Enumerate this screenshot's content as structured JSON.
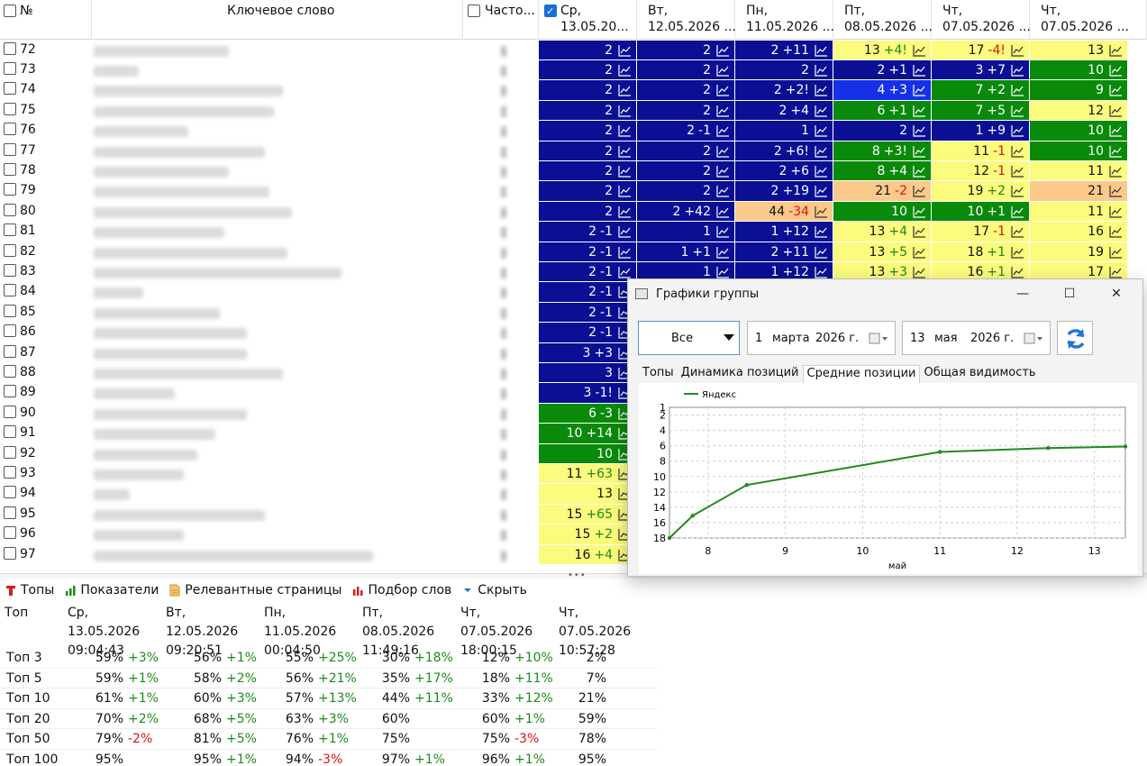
{
  "grid": {
    "header": {
      "num_label": "№",
      "keyword_label": "Ключевое слово",
      "freq_label": "Часто...",
      "date_columns": [
        {
          "day": "Ср,",
          "date": "13.05.20..."
        },
        {
          "day": "Вт,",
          "date": "12.05.2026 ..."
        },
        {
          "day": "Пн,",
          "date": "11.05.2026 ..."
        },
        {
          "day": "Пт,",
          "date": "08.05.2026 ..."
        },
        {
          "day": "Чт,",
          "date": "07.05.2026 ..."
        },
        {
          "day": "Чт,",
          "date": "07.05.2026 ..."
        }
      ]
    },
    "colors": {
      "navy": "#0a0f94",
      "blue": "#1530e6",
      "green": "#0a8a0a",
      "yellow": "#fbfb7d",
      "peach": "#fbc98a"
    },
    "rows": [
      {
        "n": "72",
        "kw_w": 150,
        "cells": [
          [
            "2",
            "",
            "navy"
          ],
          [
            "2",
            "",
            "navy"
          ],
          [
            "2",
            "+11",
            "navy"
          ],
          [
            "13",
            "+4!",
            "yellow"
          ],
          [
            "17",
            "-4!",
            "yellow"
          ],
          [
            "13",
            "",
            "yellow"
          ]
        ]
      },
      {
        "n": "73",
        "kw_w": 50,
        "cells": [
          [
            "2",
            "",
            "navy"
          ],
          [
            "2",
            "",
            "navy"
          ],
          [
            "2",
            "",
            "navy"
          ],
          [
            "2",
            "+1",
            "navy"
          ],
          [
            "3",
            "+7",
            "navy"
          ],
          [
            "10",
            "",
            "green"
          ]
        ]
      },
      {
        "n": "74",
        "kw_w": 210,
        "cells": [
          [
            "2",
            "",
            "navy"
          ],
          [
            "2",
            "",
            "navy"
          ],
          [
            "2",
            "+2!",
            "navy"
          ],
          [
            "4",
            "+3",
            "blue"
          ],
          [
            "7",
            "+2",
            "green"
          ],
          [
            "9",
            "",
            "green"
          ]
        ]
      },
      {
        "n": "75",
        "kw_w": 200,
        "cells": [
          [
            "2",
            "",
            "navy"
          ],
          [
            "2",
            "",
            "navy"
          ],
          [
            "2",
            "+4",
            "navy"
          ],
          [
            "6",
            "+1",
            "green"
          ],
          [
            "7",
            "+5",
            "green"
          ],
          [
            "12",
            "",
            "yellow"
          ]
        ]
      },
      {
        "n": "76",
        "kw_w": 105,
        "cells": [
          [
            "2",
            "",
            "navy"
          ],
          [
            "2",
            "-1",
            "navy"
          ],
          [
            "1",
            "",
            "navy"
          ],
          [
            "2",
            "",
            "navy"
          ],
          [
            "1",
            "+9",
            "navy"
          ],
          [
            "10",
            "",
            "green"
          ]
        ]
      },
      {
        "n": "77",
        "kw_w": 190,
        "cells": [
          [
            "2",
            "",
            "navy"
          ],
          [
            "2",
            "",
            "navy"
          ],
          [
            "2",
            "+6!",
            "navy"
          ],
          [
            "8",
            "+3!",
            "green"
          ],
          [
            "11",
            "-1",
            "yellow"
          ],
          [
            "10",
            "",
            "green"
          ]
        ]
      },
      {
        "n": "78",
        "kw_w": 150,
        "cells": [
          [
            "2",
            "",
            "navy"
          ],
          [
            "2",
            "",
            "navy"
          ],
          [
            "2",
            "+6",
            "navy"
          ],
          [
            "8",
            "+4",
            "green"
          ],
          [
            "12",
            "-1",
            "yellow"
          ],
          [
            "11",
            "",
            "yellow"
          ]
        ]
      },
      {
        "n": "79",
        "kw_w": 195,
        "cells": [
          [
            "2",
            "",
            "navy"
          ],
          [
            "2",
            "",
            "navy"
          ],
          [
            "2",
            "+19",
            "navy"
          ],
          [
            "21",
            "-2",
            "peach"
          ],
          [
            "19",
            "+2",
            "yellow"
          ],
          [
            "21",
            "",
            "peach"
          ]
        ]
      },
      {
        "n": "80",
        "kw_w": 220,
        "cells": [
          [
            "2",
            "",
            "navy"
          ],
          [
            "2",
            "+42",
            "navy"
          ],
          [
            "44",
            "-34",
            "peach"
          ],
          [
            "10",
            "",
            "green"
          ],
          [
            "10",
            "+1",
            "green"
          ],
          [
            "11",
            "",
            "yellow"
          ]
        ]
      },
      {
        "n": "81",
        "kw_w": 145,
        "cells": [
          [
            "2",
            "-1",
            "navy"
          ],
          [
            "1",
            "",
            "navy"
          ],
          [
            "1",
            "+12",
            "navy"
          ],
          [
            "13",
            "+4",
            "yellow"
          ],
          [
            "17",
            "-1",
            "yellow"
          ],
          [
            "16",
            "",
            "yellow"
          ]
        ]
      },
      {
        "n": "82",
        "kw_w": 215,
        "cells": [
          [
            "2",
            "-1",
            "navy"
          ],
          [
            "1",
            "+1",
            "navy"
          ],
          [
            "2",
            "+11",
            "navy"
          ],
          [
            "13",
            "+5",
            "yellow"
          ],
          [
            "18",
            "+1",
            "yellow"
          ],
          [
            "19",
            "",
            "yellow"
          ]
        ]
      },
      {
        "n": "83",
        "kw_w": 275,
        "cells": [
          [
            "2",
            "-1",
            "navy"
          ],
          [
            "1",
            "",
            "navy"
          ],
          [
            "1",
            "+12",
            "navy"
          ],
          [
            "13",
            "+3",
            "yellow"
          ],
          [
            "16",
            "+1",
            "yellow"
          ],
          [
            "17",
            "",
            "yellow"
          ]
        ]
      },
      {
        "n": "84",
        "kw_w": 55,
        "cells": [
          [
            "2",
            "-1",
            "navy"
          ]
        ]
      },
      {
        "n": "85",
        "kw_w": 140,
        "cells": [
          [
            "2",
            "-1",
            "navy"
          ]
        ]
      },
      {
        "n": "86",
        "kw_w": 170,
        "cells": [
          [
            "2",
            "-1",
            "navy"
          ]
        ]
      },
      {
        "n": "87",
        "kw_w": 170,
        "cells": [
          [
            "3",
            "+3",
            "navy"
          ]
        ]
      },
      {
        "n": "88",
        "kw_w": 210,
        "cells": [
          [
            "3",
            "",
            "navy"
          ]
        ]
      },
      {
        "n": "89",
        "kw_w": 90,
        "cells": [
          [
            "3",
            "-1!",
            "navy"
          ]
        ]
      },
      {
        "n": "90",
        "kw_w": 170,
        "cells": [
          [
            "6",
            "-3",
            "green"
          ]
        ]
      },
      {
        "n": "91",
        "kw_w": 135,
        "cells": [
          [
            "10",
            "+14",
            "green"
          ]
        ]
      },
      {
        "n": "92",
        "kw_w": 115,
        "cells": [
          [
            "10",
            "",
            "green"
          ]
        ]
      },
      {
        "n": "93",
        "kw_w": 100,
        "cells": [
          [
            "11",
            "+63",
            "yellow"
          ]
        ]
      },
      {
        "n": "94",
        "kw_w": 40,
        "cells": [
          [
            "13",
            "",
            "yellow"
          ]
        ]
      },
      {
        "n": "95",
        "kw_w": 190,
        "cells": [
          [
            "15",
            "+65",
            "yellow"
          ]
        ]
      },
      {
        "n": "96",
        "kw_w": 100,
        "cells": [
          [
            "15",
            "+2",
            "yellow"
          ]
        ]
      },
      {
        "n": "97",
        "kw_w": 310,
        "cells": [
          [
            "16",
            "+4",
            "yellow"
          ]
        ]
      }
    ]
  },
  "splitter_glyph": "•••",
  "toolbar": {
    "items": [
      {
        "label": "Топы",
        "icon": "tops-icon"
      },
      {
        "label": "Показатели",
        "icon": "bar-chart-icon"
      },
      {
        "label": "Релевантные страницы",
        "icon": "document-icon"
      },
      {
        "label": "Подбор слов",
        "icon": "bar-chart-red-icon"
      },
      {
        "label": "Скрыть",
        "icon": "chevron-down-icon"
      }
    ]
  },
  "tops_table": {
    "header_label": "Топ",
    "columns": [
      {
        "day": "Ср, 13.05.2026",
        "time": "09:04:43"
      },
      {
        "day": "Вт, 12.05.2026",
        "time": "09:20:51"
      },
      {
        "day": "Пн, 11.05.2026",
        "time": "00:04:50"
      },
      {
        "day": "Пт, 08.05.2026",
        "time": "11:49:16"
      },
      {
        "day": "Чт, 07.05.2026",
        "time": "18:00:15"
      },
      {
        "day": "Чт, 07.05.2026",
        "time": "10:57:28"
      }
    ],
    "rows": [
      {
        "label": "Топ 3",
        "cells": [
          [
            "59%",
            "+3%"
          ],
          [
            "56%",
            "+1%"
          ],
          [
            "55%",
            "+25%"
          ],
          [
            "30%",
            "+18%"
          ],
          [
            "12%",
            "+10%"
          ],
          [
            "2%",
            ""
          ]
        ]
      },
      {
        "label": "Топ 5",
        "cells": [
          [
            "59%",
            "+1%"
          ],
          [
            "58%",
            "+2%"
          ],
          [
            "56%",
            "+21%"
          ],
          [
            "35%",
            "+17%"
          ],
          [
            "18%",
            "+11%"
          ],
          [
            "7%",
            ""
          ]
        ]
      },
      {
        "label": "Топ 10",
        "cells": [
          [
            "61%",
            "+1%"
          ],
          [
            "60%",
            "+3%"
          ],
          [
            "57%",
            "+13%"
          ],
          [
            "44%",
            "+11%"
          ],
          [
            "33%",
            "+12%"
          ],
          [
            "21%",
            ""
          ]
        ]
      },
      {
        "label": "Топ 20",
        "cells": [
          [
            "70%",
            "+2%"
          ],
          [
            "68%",
            "+5%"
          ],
          [
            "63%",
            "+3%"
          ],
          [
            "60%",
            ""
          ],
          [
            "60%",
            "+1%"
          ],
          [
            "59%",
            ""
          ]
        ]
      },
      {
        "label": "Топ 50",
        "cells": [
          [
            "79%",
            "-2%"
          ],
          [
            "81%",
            "+5%"
          ],
          [
            "76%",
            "+1%"
          ],
          [
            "75%",
            ""
          ],
          [
            "75%",
            "-3%"
          ],
          [
            "78%",
            ""
          ]
        ]
      },
      {
        "label": "Топ 100",
        "cells": [
          [
            "95%",
            ""
          ],
          [
            "95%",
            "+1%"
          ],
          [
            "94%",
            "-3%"
          ],
          [
            "97%",
            "+1%"
          ],
          [
            "96%",
            "+1%"
          ],
          [
            "95%",
            ""
          ]
        ]
      }
    ]
  },
  "window": {
    "title": "Графики группы",
    "minimize": "—",
    "maximize": "☐",
    "close": "✕",
    "filter_select": "Все",
    "date_from": {
      "day": "1",
      "month": "марта",
      "year": "2026 г."
    },
    "date_to": {
      "day": "13",
      "month": "мая",
      "year": "2026 г."
    },
    "tabs": [
      "Топы",
      "Динамика позиций",
      "Средние позиции",
      "Общая видимость"
    ],
    "active_tab": 2
  },
  "chart_data": {
    "type": "line",
    "title": "",
    "xlabel": "май",
    "ylabel": "",
    "x_ticks": [
      8,
      9,
      10,
      11,
      12,
      13
    ],
    "y_ticks": [
      1,
      2,
      4,
      6,
      8,
      10,
      12,
      14,
      16,
      18
    ],
    "xlim": [
      7.5,
      13.4
    ],
    "ylim": [
      18,
      1
    ],
    "y_inverted": true,
    "grid": true,
    "legend": "top-left",
    "series": [
      {
        "name": "Яндекс",
        "color": "#1f8a1f",
        "x": [
          7.5,
          7.8,
          8.5,
          11.0,
          12.4,
          13.4
        ],
        "y": [
          18.0,
          15.1,
          11.1,
          6.8,
          6.3,
          6.1
        ]
      }
    ]
  }
}
